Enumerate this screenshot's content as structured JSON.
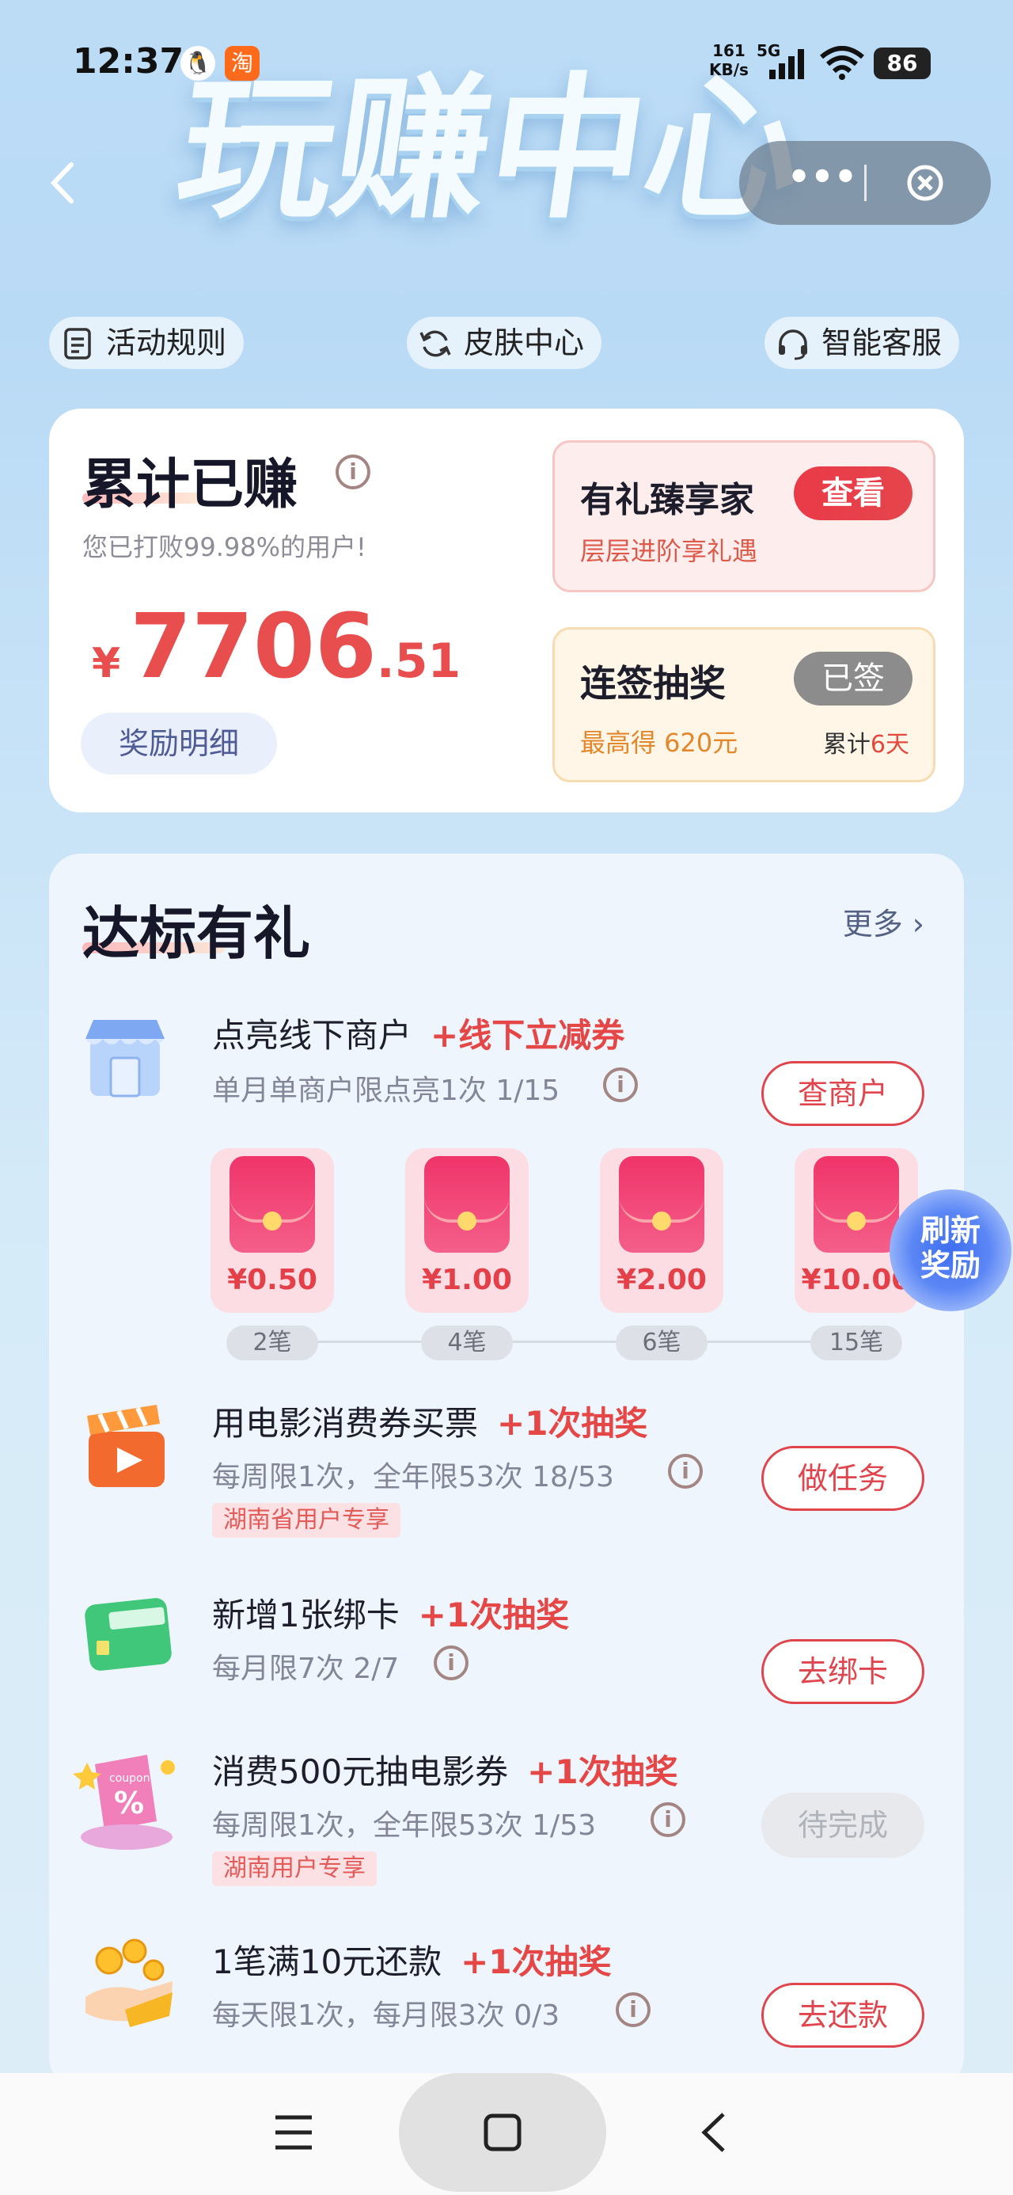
{
  "status_bar": {
    "time": "12:37",
    "app_icons": [
      "qq-icon",
      "taobao-icon"
    ],
    "taobao_label": "淘",
    "net_speed_value": "161",
    "net_speed_unit": "KB/s",
    "network": "5G",
    "battery": "86"
  },
  "header": {
    "title": "玩赚中心",
    "capsule_more": "•••"
  },
  "top_links": [
    {
      "label": "活动规则",
      "icon": "document-icon"
    },
    {
      "label": "皮肤中心",
      "icon": "refresh-icon"
    },
    {
      "label": "智能客服",
      "icon": "headset-icon"
    }
  ],
  "earnings": {
    "title": "累计已赚",
    "info": "i",
    "subtitle": "您已打败99.98%的用户!",
    "currency": "¥",
    "amount_int": "7706",
    "amount_dec": ".51",
    "detail_button": "奖励明细",
    "vip": {
      "title": "有礼臻享家",
      "button": "查看",
      "subtitle": "层层进阶享礼遇"
    },
    "sign_in": {
      "title": "连签抽奖",
      "button": "已签",
      "max_label": "最高得 620元",
      "days_prefix": "累计",
      "days_value": "6天"
    }
  },
  "rewards": {
    "title": "达标有礼",
    "more": "更多 ›",
    "refresh_line1": "刷新",
    "refresh_line2": "奖励",
    "tasks": [
      {
        "name": "点亮线下商户",
        "bonus": "+线下立减券",
        "limit": "单月单商户限点亮1次  1/15",
        "button": "查商户",
        "icon": "storefront-icon"
      },
      {
        "name": "用电影消费券买票",
        "bonus": "+1次抽奖",
        "limit": "每周限1次，全年限53次  18/53",
        "tag": "湖南省用户专享",
        "button": "做任务",
        "icon": "film-clapper-icon"
      },
      {
        "name": "新增1张绑卡",
        "bonus": "+1次抽奖",
        "limit": "每月限7次  2/7",
        "button": "去绑卡",
        "icon": "bank-card-icon"
      },
      {
        "name": "消费500元抽电影券",
        "bonus": "+1次抽奖",
        "limit": "每周限1次，全年限53次  1/53",
        "tag": "湖南用户专享",
        "button": "待完成",
        "icon": "coupon-icon"
      },
      {
        "name": "1笔满10元还款",
        "bonus": "+1次抽奖",
        "limit": "每天限1次，每月限3次  0/3",
        "button": "去还款",
        "icon": "coin-hand-icon"
      }
    ],
    "packets": [
      {
        "amount": "¥0.50",
        "step": "2笔"
      },
      {
        "amount": "¥1.00",
        "step": "4笔"
      },
      {
        "amount": "¥2.00",
        "step": "6笔"
      },
      {
        "amount": "¥10.00",
        "step": "15笔"
      }
    ]
  },
  "colors": {
    "accent_red": "#e54646",
    "background_sky": "#bcdcf6",
    "card_white": "#ffffff"
  }
}
